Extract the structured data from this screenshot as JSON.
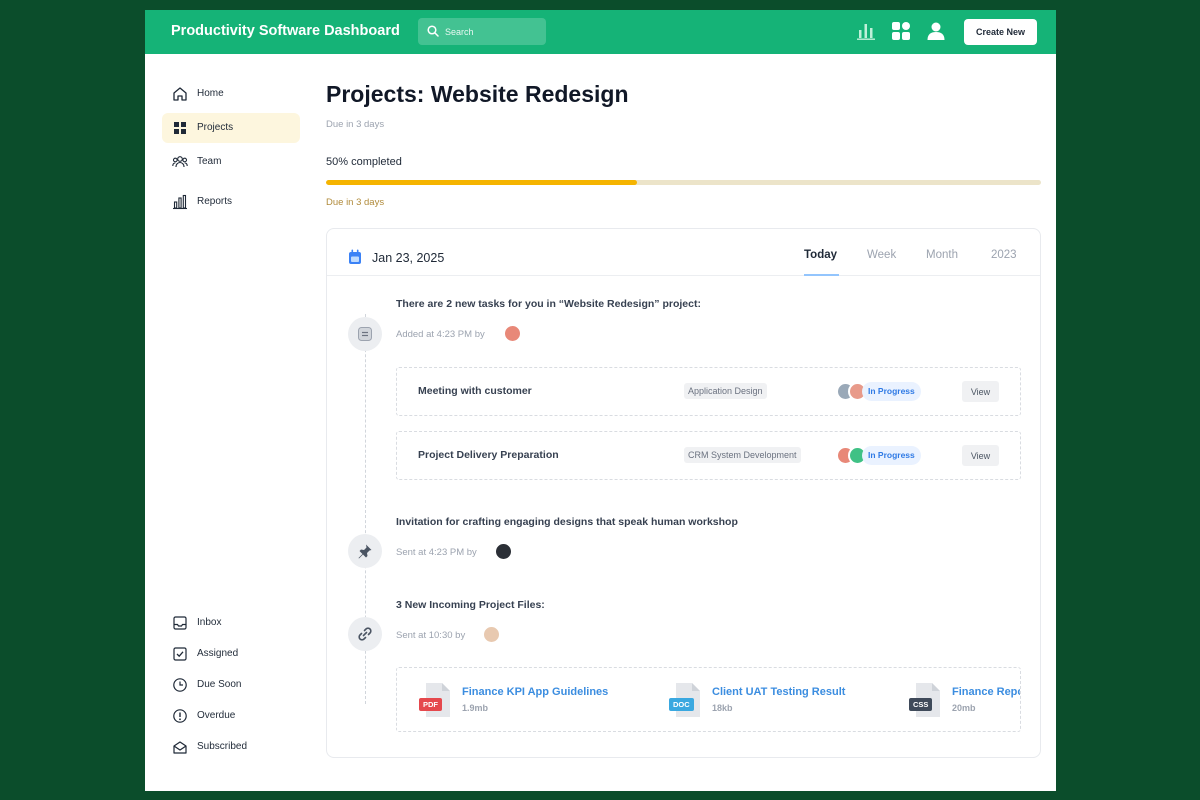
{
  "colors": {
    "brand": "#15b377",
    "page_bg": "#0b4d2b",
    "progress": "#f5b400",
    "status": "#2f7ae5",
    "link": "#3b8de0"
  },
  "header": {
    "title": "Productivity Software Dashboard",
    "search_placeholder": "Search",
    "icons": [
      "chart-icon",
      "grid-icon",
      "user-icon"
    ],
    "create_label": "Create New"
  },
  "sidebar": {
    "items": [
      {
        "label": "Home",
        "icon": "home-icon",
        "active": false
      },
      {
        "label": "Projects",
        "icon": "grid-icon",
        "active": true
      },
      {
        "label": "Team",
        "icon": "team-icon",
        "active": false
      },
      {
        "label": "Reports",
        "icon": "reports-icon",
        "active": false
      }
    ],
    "bottom_items": [
      {
        "label": "Inbox",
        "icon": "inbox-icon"
      },
      {
        "label": "Assigned",
        "icon": "checkbox-icon"
      },
      {
        "label": "Due Soon",
        "icon": "clock-icon"
      },
      {
        "label": "Overdue",
        "icon": "alert-icon"
      },
      {
        "label": "Subscribed",
        "icon": "envelope-icon"
      }
    ]
  },
  "main": {
    "title": "Projects: Website Redesign",
    "due_top": "Due in 3 days",
    "progress_label": "50% completed",
    "progress_value": 0.435,
    "due_bottom": "Due in 3 days"
  },
  "activity": {
    "date": "Jan 23, 2025",
    "tabs": [
      "Today",
      "Week",
      "Month",
      "2023"
    ],
    "active_tab": "Today",
    "entries": [
      {
        "title": "There are 2 new tasks for you in “Website Redesign” project:",
        "meta": "Added at 4:23 PM by",
        "icon": "document-icon",
        "tasks": [
          {
            "name": "Meeting with customer",
            "tag": "Application Design",
            "status": "In Progress",
            "action": "View"
          },
          {
            "name": "Project Delivery Preparation",
            "tag": "CRM System Development",
            "status": "In Progress",
            "action": "View"
          }
        ]
      },
      {
        "title": "Invitation for crafting engaging designs  that speak human workshop",
        "meta": "Sent at 4:23 PM by",
        "icon": "pin-icon"
      },
      {
        "title": "3 New Incoming Project Files:",
        "meta": "Sent at 10:30 by",
        "icon": "link-icon",
        "files": [
          {
            "name": "Finance KPI App Guidelines",
            "size": "1.9mb",
            "type": "PDF",
            "color": "#e5484d"
          },
          {
            "name": "Client UAT Testing Result",
            "size": "18kb",
            "type": "DOC",
            "color": "#3aa8e0"
          },
          {
            "name": "Finance Report",
            "size": "20mb",
            "type": "CSS",
            "color": "#3f4a5a"
          }
        ]
      }
    ]
  }
}
